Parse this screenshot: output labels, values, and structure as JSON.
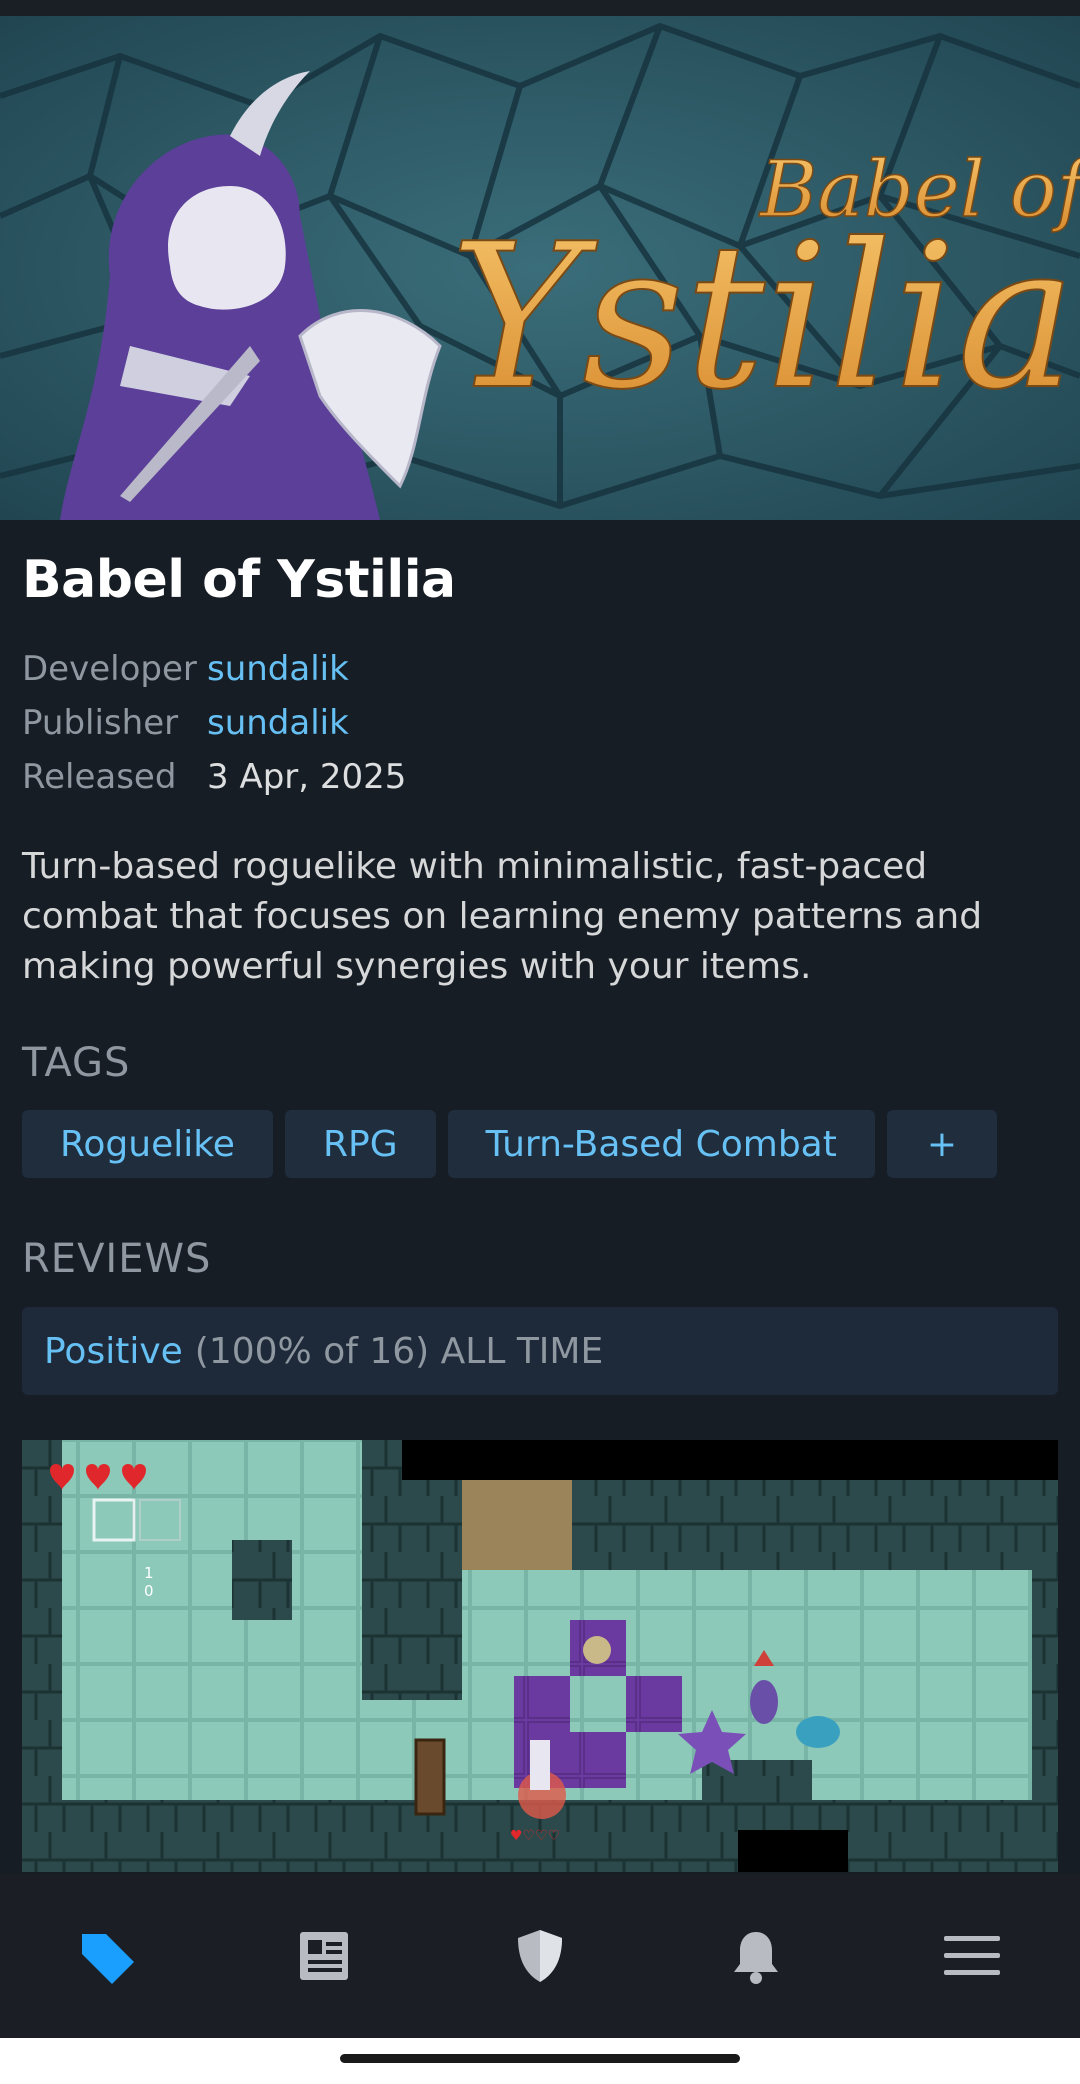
{
  "hero": {
    "logo_small": "Babel of",
    "logo_big": "Ystilia"
  },
  "game": {
    "title": "Babel of Ystilia",
    "meta": [
      {
        "label": "Developer",
        "value": "sundalik"
      },
      {
        "label": "Publisher",
        "value": "sundalik"
      },
      {
        "label": "Released",
        "value": "3 Apr, 2025"
      }
    ],
    "description": "Turn-based roguelike with minimalistic, fast-paced combat that focuses on learning enemy patterns and making powerful synergies with your items."
  },
  "tags": {
    "heading": "TAGS",
    "items": [
      "Roguelike",
      "RPG",
      "Turn-Based Combat",
      "+"
    ]
  },
  "reviews": {
    "heading": "REVIEWS",
    "summary": "Positive",
    "detail": "(100% of 16) ALL TIME"
  },
  "screenshot": {
    "hud_attack": "1",
    "hud_shield": "0"
  },
  "nav": {
    "items": [
      "tag-icon",
      "news-icon",
      "shield-icon",
      "bell-icon",
      "menu-icon"
    ],
    "active": "tag-icon"
  },
  "colors": {
    "background": "#171d25",
    "accent": "#66c0f4",
    "tag_bg": "#1f2d3d",
    "active_nav": "#1a9fff"
  }
}
